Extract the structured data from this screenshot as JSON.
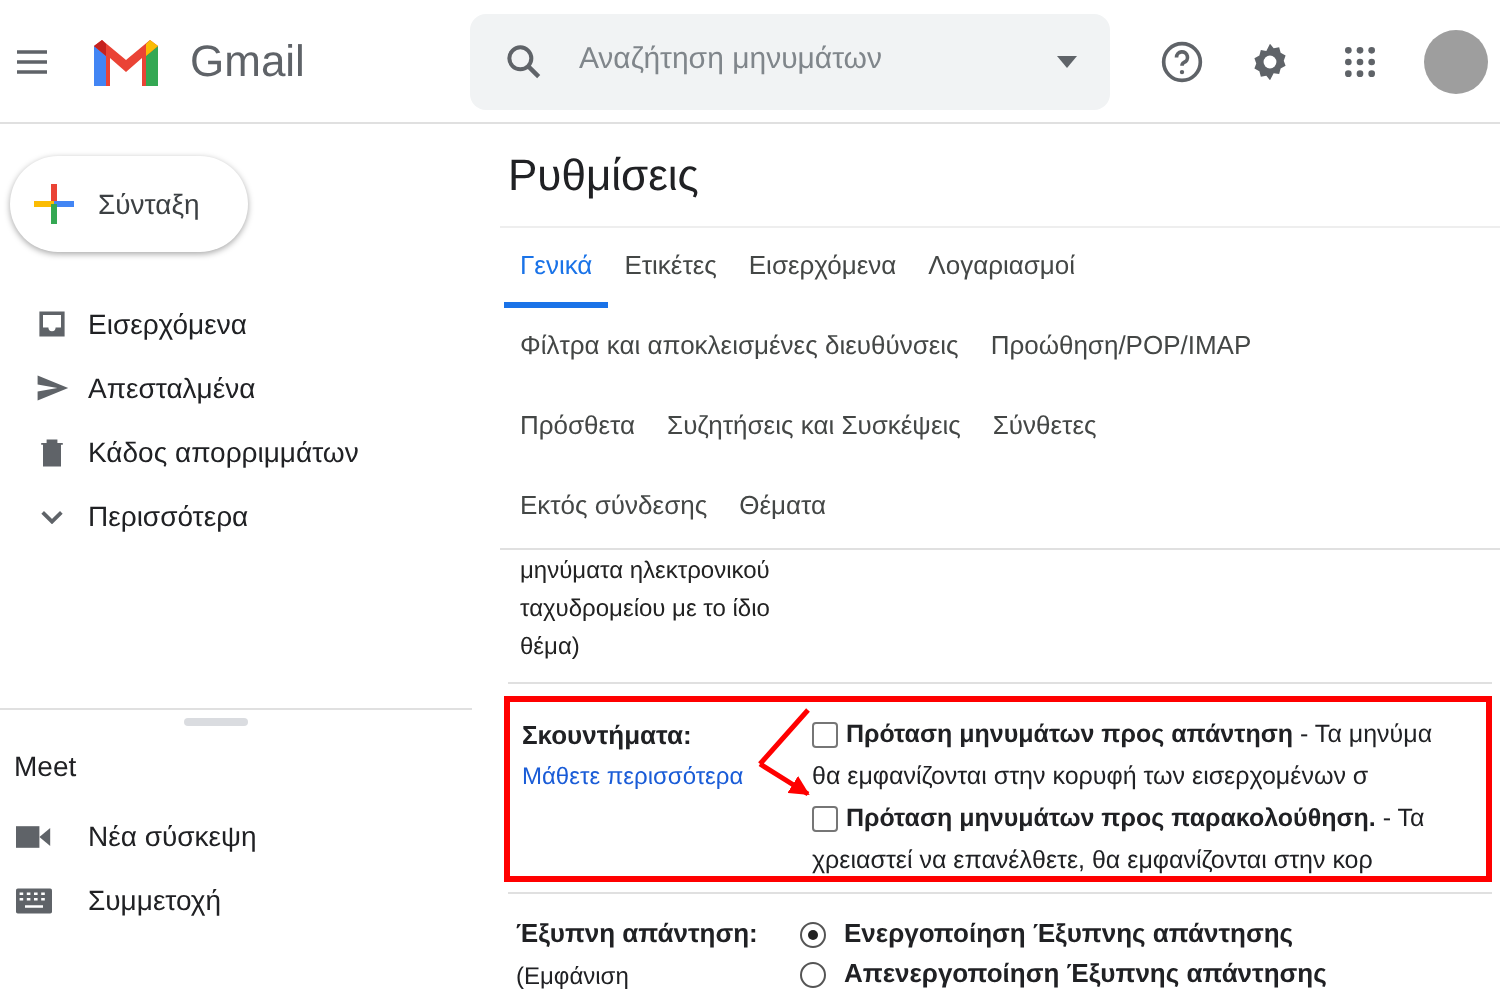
{
  "header": {
    "app_name": "Gmail",
    "search": {
      "placeholder": "Αναζήτηση μηνυμάτων"
    }
  },
  "sidebar": {
    "compose": "Σύνταξη",
    "items": [
      {
        "label": "Εισερχόμενα"
      },
      {
        "label": "Απεσταλμένα"
      },
      {
        "label": "Κάδος απορριμμάτων"
      },
      {
        "label": "Περισσότερα"
      }
    ],
    "meet": {
      "title": "Meet",
      "items": [
        {
          "label": "Νέα σύσκεψη"
        },
        {
          "label": "Συμμετοχή"
        }
      ]
    }
  },
  "settings": {
    "title": "Ρυθμίσεις",
    "tab_rows": [
      [
        {
          "label": "Γενικά",
          "selected": true
        },
        {
          "label": "Ετικέτες",
          "selected": false
        },
        {
          "label": "Εισερχόμενα",
          "selected": false
        },
        {
          "label": "Λογαριασμοί",
          "selected": false
        }
      ],
      [
        {
          "label": "Φίλτρα και αποκλεισμένες διευθύνσεις",
          "selected": false
        },
        {
          "label": "Προώθηση/POP/IMAP",
          "selected": false
        }
      ],
      [
        {
          "label": "Πρόσθετα",
          "selected": false
        },
        {
          "label": "Συζητήσεις και Συσκέψεις",
          "selected": false
        },
        {
          "label": "Σύνθετες",
          "selected": false
        }
      ],
      [
        {
          "label": "Εκτός σύνδεσης",
          "selected": false
        },
        {
          "label": "Θέματα",
          "selected": false
        }
      ]
    ],
    "scrolled_text": [
      "μηνύματα ηλεκτρονικού",
      "ταχυδρομείου με το ίδιο",
      "θέμα)"
    ],
    "nudges": {
      "label": "Σκουντήματα:",
      "link": "Μάθετε περισσότερα",
      "options": [
        {
          "checked": false,
          "text": "**Πρόταση μηνυμάτων προς απάντηση** - Τα μηνύμα",
          "continuation": "θα εμφανίζονται στην κορυφή των εισερχομένων σ"
        },
        {
          "checked": false,
          "text": "**Πρόταση μηνυμάτων προς παρακολούθηση.** - Τα",
          "continuation": "χρειαστεί να επανέλθετε, θα εμφανίζονται στην κορ"
        }
      ]
    },
    "smart_reply": {
      "label": "Έξυπνη απάντηση:",
      "note": "(Εμφάνιση",
      "options": [
        {
          "label": "Ενεργοποίηση Έξυπνης απάντησης",
          "selected": true
        },
        {
          "label": "Απενεργοποίηση Έξυπνης απάντησης",
          "selected": false
        }
      ]
    }
  }
}
